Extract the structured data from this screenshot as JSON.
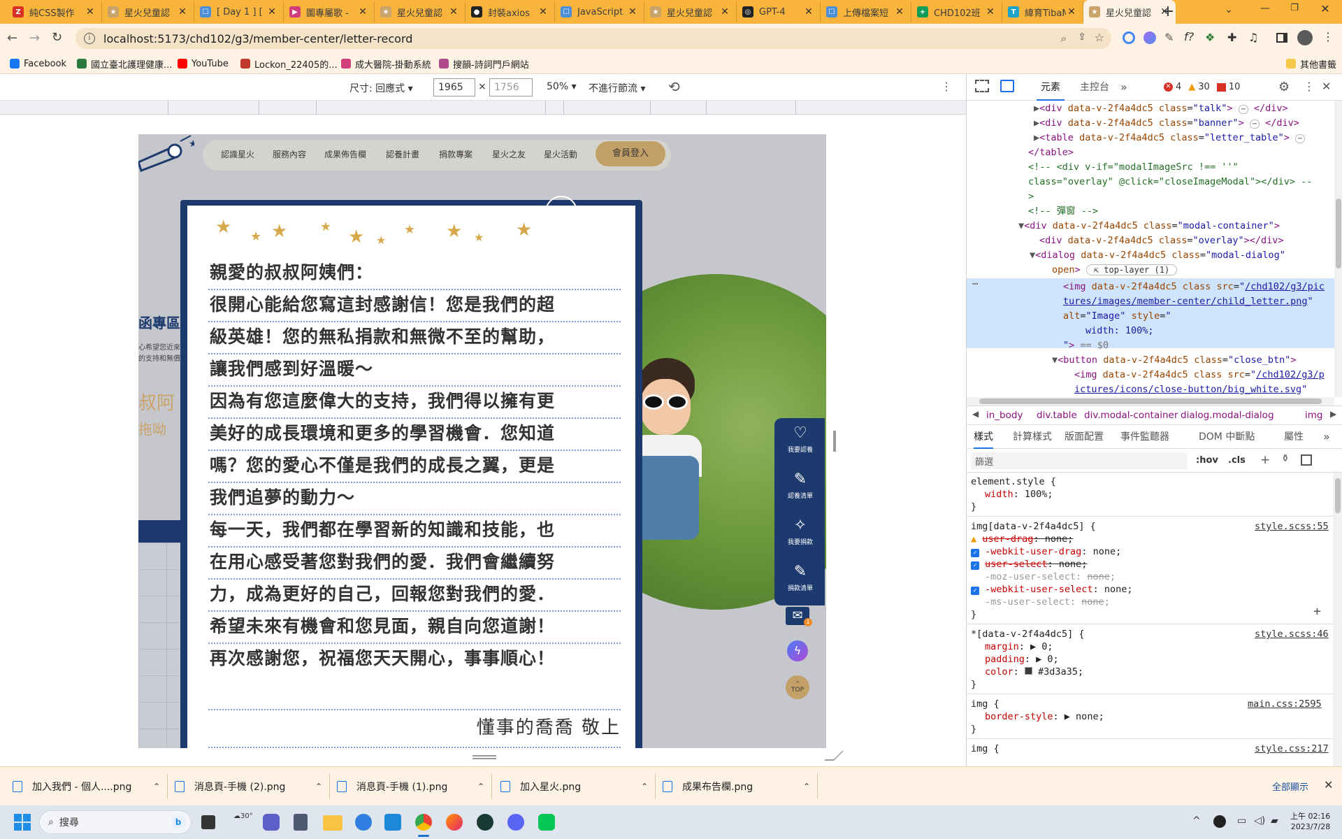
{
  "tabs": [
    {
      "label": "純CSS製作",
      "color": "#d93025",
      "glyph": "Z"
    },
    {
      "label": "星火兒童認",
      "color": "#c9a36a",
      "glyph": "★"
    },
    {
      "label": "[ Day 1 ] [",
      "color": "#4a8fd8",
      "glyph": "☐"
    },
    {
      "label": "圖專屬歌 -",
      "color": "#d23d7c",
      "glyph": "▶"
    },
    {
      "label": "星火兒童認",
      "color": "#c9a36a",
      "glyph": "★"
    },
    {
      "label": "封裝axios",
      "color": "#222",
      "glyph": "●"
    },
    {
      "label": "JavaScript",
      "color": "#4a8fd8",
      "glyph": "☐"
    },
    {
      "label": "星火兒童認",
      "color": "#c9a36a",
      "glyph": "★"
    },
    {
      "label": "GPT-4",
      "color": "#202123",
      "glyph": "◎"
    },
    {
      "label": "上傳檔案短",
      "color": "#4a8fd8",
      "glyph": "☐"
    },
    {
      "label": "CHD102班",
      "color": "#0f9d58",
      "glyph": "+"
    },
    {
      "label": "緯育TibaM",
      "color": "#1aa3c9",
      "glyph": "T"
    },
    {
      "label": "星火兒童認",
      "color": "#c9a36a",
      "glyph": "★",
      "active": true
    }
  ],
  "toolbar": {
    "url": "localhost:5173/chd102/g3/member-center/letter-record"
  },
  "bookmarks": [
    {
      "label": "Facebook",
      "color": "#1877f2"
    },
    {
      "label": "國立臺北護理健康...",
      "color": "#2b7a3d"
    },
    {
      "label": "YouTube",
      "color": "#ff0000"
    },
    {
      "label": "Lockon_22405的...",
      "color": "#c0392b"
    },
    {
      "label": "成大醫院-掛動系統",
      "color": "#d23d7c"
    },
    {
      "label": "搜韻-詩詞門戶網站",
      "color": "#b04a8a"
    }
  ],
  "bookmarks_other": "其他書籤",
  "device": {
    "size_label": "尺寸: 回應式",
    "width": "1965",
    "height": "1756",
    "zoom": "50%",
    "throttle": "不進行節流"
  },
  "site": {
    "nav": [
      "認識星火",
      "服務內容",
      "成果佈告欄",
      "認養計畫",
      "捐款專案",
      "星火之友",
      "星火活動"
    ],
    "login": "會員登入",
    "left_title": "函專區",
    "left_text1": "心希望您近來",
    "left_text2": "的支持和無償",
    "left_script1": "叔阿",
    "left_script2": "拖呦",
    "side_buttons": [
      "我要認養",
      "認養清單",
      "我要捐款",
      "捐款清單"
    ],
    "top_label": "TOP",
    "mail_badge": "1"
  },
  "letter": {
    "lines": [
      "親愛的叔叔阿姨們：",
      "很開心能給您寫這封感謝信！您是我們的超",
      "級英雄！您的無私捐款和無微不至的幫助，",
      "讓我們感到好溫暖～",
      "因為有您這麼偉大的支持，我們得以擁有更",
      "美好的成長環境和更多的學習機會．您知道",
      "嗎？您的愛心不僅是我們的成長之翼，更是",
      "我們追夢的動力～",
      "每一天，我們都在學習新的知識和技能，也",
      "在用心感受著您對我們的愛．我們會繼續努",
      "力，成為更好的自己，回報您對我們的愛．",
      "希望未來有機會和您見面，親自向您道謝！",
      "再次感謝您，祝福您天天開心，事事順心！"
    ],
    "signature": "懂事的喬喬  敬上"
  },
  "devtools": {
    "tabs": [
      "元素",
      "主控台"
    ],
    "errors": "4",
    "warnings": "30",
    "issues": "10",
    "dom_lines": [
      {
        "indent": 0,
        "tri": "▶",
        "html": "talk"
      },
      {
        "indent": 0,
        "tri": "▶",
        "html": "banner"
      },
      {
        "indent": 0,
        "tri": "▶",
        "html": "letter_table"
      }
    ],
    "img_src": "/chd102/g3/pictures/images/member-center/child_letter.png",
    "img_src_1": "/chd102/g3/pic",
    "img_src_2": "tures/images/member-center/child_letter.png",
    "btn_src_1": "/chd102/g3/p",
    "btn_src_2": "ictures/icons/close-button/big_white.svg",
    "breadcrumb": [
      "in_body",
      "div.table",
      "div.modal-container",
      "dialog.modal-dialog",
      "img"
    ],
    "style_tabs": [
      "樣式",
      "計算樣式",
      "版面配置",
      "事件監聽器",
      "DOM 中斷點",
      "屬性"
    ],
    "filter_placeholder": "篩選",
    "hov": ":hov",
    "cls": ".cls",
    "rules": {
      "r1_source": "style.scss:55",
      "r2_source": "style.scss:46",
      "r3_source": "main.css:2595",
      "r4_source": "style.css:217",
      "color_value": "#3d3a35"
    }
  },
  "downloads": [
    {
      "label": "加入我們 - 個人....png"
    },
    {
      "label": "消息頁-手機 (2).png"
    },
    {
      "label": "消息頁-手機 (1).png"
    },
    {
      "label": "加入星火.png"
    },
    {
      "label": "成果布告欄.png"
    }
  ],
  "downloads_show_all": "全部顯示",
  "taskbar": {
    "search_placeholder": "搜尋",
    "weather": "30°",
    "time": "上午 02:16",
    "date": "2023/7/28"
  }
}
